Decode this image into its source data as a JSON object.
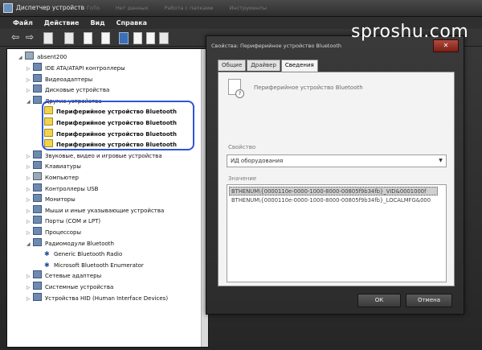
{
  "window": {
    "title": "Диспетчер устройств",
    "ghost_tabs": [
      "ГоТо",
      "Нет данных",
      "Работа с папками",
      "Инструменты"
    ]
  },
  "menu": [
    "Файл",
    "Действие",
    "Вид",
    "Справка"
  ],
  "toolbar": {
    "icons": [
      "back-icon",
      "forward-icon",
      "computer-icon",
      "folder-icon",
      "properties-icon",
      "help-icon",
      "update-driver-icon",
      "uninstall-icon",
      "disable-icon",
      "scan-icon"
    ]
  },
  "tree": {
    "root": "absent200",
    "items": [
      {
        "label": "IDE ATA/ATAPI контроллеры",
        "level": 1,
        "icon": "controller-icon"
      },
      {
        "label": "Видеоадаптеры",
        "level": 1,
        "icon": "display-adapter-icon"
      },
      {
        "label": "Дисковые устройства",
        "level": 1,
        "icon": "disk-icon"
      },
      {
        "label": "Другие устройства",
        "level": 1,
        "icon": "other-devices-icon",
        "expanded": true
      },
      {
        "label": "Периферийное устройство Bluetooth",
        "level": 2,
        "icon": "warning-icon"
      },
      {
        "label": "Периферийное устройство Bluetooth",
        "level": 2,
        "icon": "warning-icon"
      },
      {
        "label": "Периферийное устройство Bluetooth",
        "level": 2,
        "icon": "warning-icon"
      },
      {
        "label": "Периферийное устройство Bluetooth",
        "level": 2,
        "icon": "warning-icon"
      },
      {
        "label": "Звуковые, видео и игровые устройства",
        "level": 1,
        "icon": "sound-icon"
      },
      {
        "label": "Клавиатуры",
        "level": 1,
        "icon": "keyboard-icon"
      },
      {
        "label": "Компьютер",
        "level": 1,
        "icon": "computer-icon"
      },
      {
        "label": "Контроллеры USB",
        "level": 1,
        "icon": "usb-icon"
      },
      {
        "label": "Мониторы",
        "level": 1,
        "icon": "monitor-icon"
      },
      {
        "label": "Мыши и иные указывающие устройства",
        "level": 1,
        "icon": "mouse-icon"
      },
      {
        "label": "Порты (COM и LPT)",
        "level": 1,
        "icon": "port-icon"
      },
      {
        "label": "Процессоры",
        "level": 1,
        "icon": "processor-icon"
      },
      {
        "label": "Радиомодули Bluetooth",
        "level": 1,
        "icon": "bluetooth-icon",
        "expanded": true
      },
      {
        "label": "Generic Bluetooth Radio",
        "level": 2,
        "icon": "bluetooth-icon"
      },
      {
        "label": "Microsoft Bluetooth Enumerator",
        "level": 2,
        "icon": "bluetooth-icon"
      },
      {
        "label": "Сетевые адаптеры",
        "level": 1,
        "icon": "network-icon"
      },
      {
        "label": "Системные устройства",
        "level": 1,
        "icon": "system-icon"
      },
      {
        "label": "Устройства HID (Human Interface Devices)",
        "level": 1,
        "icon": "hid-icon"
      }
    ]
  },
  "dialog": {
    "title": "Свойства: Периферийное устройство Bluetooth",
    "close": "✕",
    "tabs": [
      "Общие",
      "Драйвер",
      "Сведения"
    ],
    "active_tab": "Сведения",
    "device_name": "Периферийное устройство Bluetooth",
    "property_label": "Свойство",
    "property_value": "ИД оборудования",
    "value_label": "Значение",
    "values": [
      "BTHENUM\\{0000110e-0000-1000-8000-00805f9b34fb}_VID&0001000f",
      "BTHENUM\\{0000110e-0000-1000-8000-00805f9b34fb}_LOCALMFG&000"
    ],
    "ok": "ОК",
    "cancel": "Отмена"
  },
  "watermark": "sproshu.com",
  "colors": {
    "highlight": "#2f55d4",
    "arrow": "#b9e06a"
  }
}
